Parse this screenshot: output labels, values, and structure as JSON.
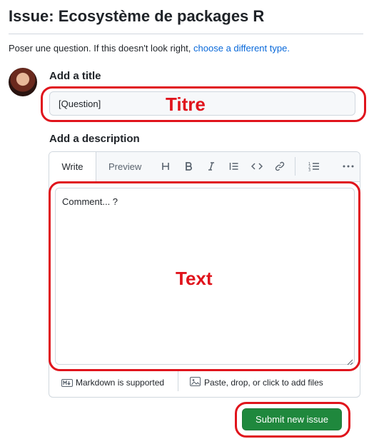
{
  "page": {
    "title": "Issue: Ecosystème de packages R",
    "subtitle_prefix": "Poser une question. If this doesn't look right, ",
    "subtitle_link": "choose a different type.",
    "avatar": "user-avatar"
  },
  "title_field": {
    "label": "Add a title",
    "value": "[Question]"
  },
  "description": {
    "label": "Add a description",
    "tabs": [
      {
        "label": "Write",
        "active": true
      },
      {
        "label": "Preview",
        "active": false
      }
    ],
    "toolbar_icons": [
      "heading-icon",
      "bold-icon",
      "italic-icon",
      "quote-icon",
      "code-icon",
      "link-icon",
      "ordered-list-icon",
      "more-icon"
    ],
    "value": "Comment... ?"
  },
  "footer": {
    "markdown": "Markdown is supported",
    "attach": "Paste, drop, or click to add files"
  },
  "submit": {
    "label": "Submit new issue"
  },
  "annotations": {
    "title_label": "Titre",
    "text_label": "Text",
    "color": "#e0141c"
  },
  "colors": {
    "submit_bg": "#1f883d",
    "link": "#0969da",
    "border": "#d0d7de"
  }
}
